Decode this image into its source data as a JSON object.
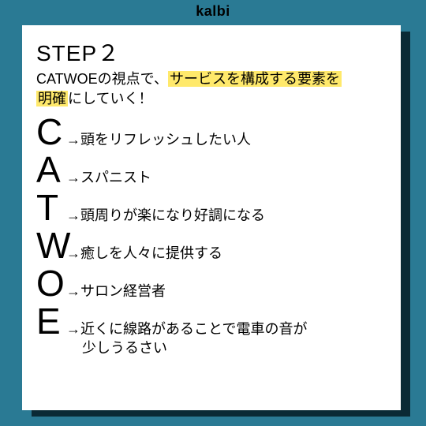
{
  "brand": "kalbi",
  "step": "STEP２",
  "subtitle_pre": "CATWOEの視点で、",
  "subtitle_hl1": "サービスを構成する要素を",
  "subtitle_hl2": "明確",
  "subtitle_post": "にしていく！",
  "items": [
    {
      "letter": "C",
      "desc": "→頭をリフレッシュしたい人"
    },
    {
      "letter": "A",
      "desc": "→スパニスト"
    },
    {
      "letter": "T",
      "desc": "→頭周りが楽になり好調になる"
    },
    {
      "letter": "W",
      "desc": "→癒しを人々に提供する"
    },
    {
      "letter": "O",
      "desc": "→サロン経営者"
    },
    {
      "letter": "E",
      "desc": "→近くに線路があることで電車の音が",
      "desc2": "少しうるさい"
    }
  ]
}
